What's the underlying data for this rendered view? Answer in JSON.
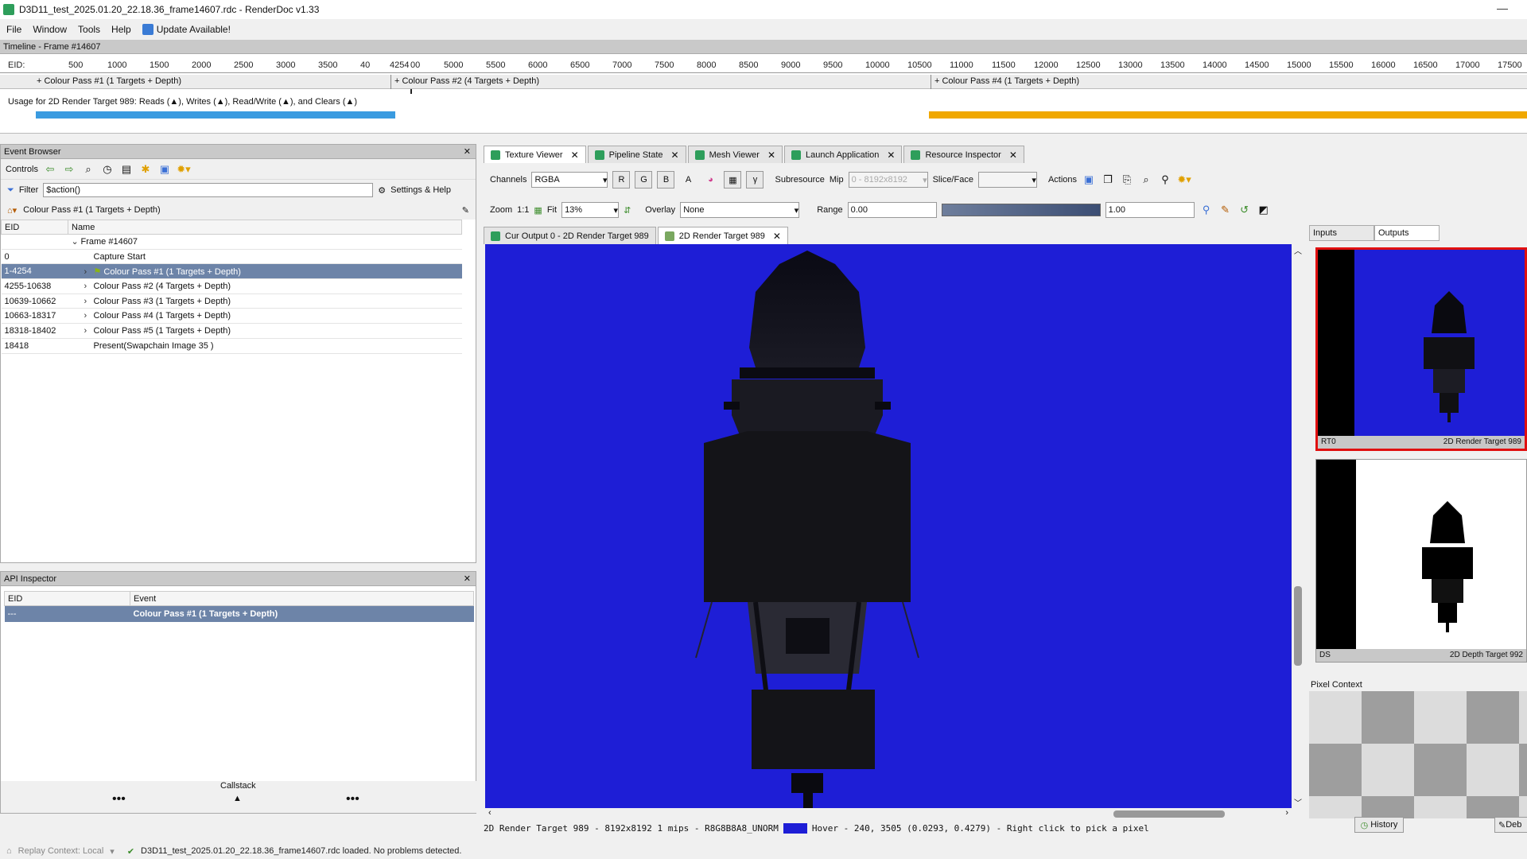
{
  "window": {
    "title": "D3D11_test_2025.01.20_22.18.36_frame14607.rdc - RenderDoc v1.33",
    "minimize": "—"
  },
  "menu": {
    "file": "File",
    "window": "Window",
    "tools": "Tools",
    "help": "Help",
    "update": "Update Available!"
  },
  "timeline": {
    "title": "Timeline - Frame #14607",
    "eid_label": "EID:",
    "ticks": [
      "500",
      "1000",
      "1500",
      "2000",
      "2500",
      "3000",
      "3500",
      "40",
      "4254",
      "00",
      "5000",
      "5500",
      "6000",
      "6500",
      "7000",
      "7500",
      "8000",
      "8500",
      "9000",
      "9500",
      "10000",
      "10500",
      "11000",
      "11500",
      "12000",
      "12500",
      "13000",
      "13500",
      "14000",
      "14500",
      "15000",
      "15500",
      "16000",
      "16500",
      "17000",
      "17500"
    ],
    "passes": [
      "+ Colour Pass #1 (1 Targets + Depth)",
      "+ Colour Pass #2 (4 Targets + Depth)",
      "+ Colour Pass #4 (1 Targets + Depth)"
    ],
    "usage_text": "Usage for 2D Render Target 989: Reads (▲), Writes (▲), Read/Write (▲), and Clears (▲)",
    "colors": {
      "reads": "#3a9be0",
      "writes": "#f0a800"
    }
  },
  "event_browser": {
    "title": "Event Browser",
    "controls": "Controls",
    "filter_label": "Filter",
    "filter_value": "$action()",
    "settings_help": "Settings & Help",
    "breadcrumb": "Colour Pass #1 (1 Targets + Depth)",
    "col_eid": "EID",
    "col_name": "Name",
    "rows": [
      {
        "eid": "",
        "name": "Frame #14607",
        "chev": "⌄",
        "indent": 0
      },
      {
        "eid": "0",
        "name": "Capture Start",
        "chev": "",
        "indent": 1
      },
      {
        "eid": "1-4254",
        "name": "Colour Pass #1 (1 Targets + Depth)",
        "chev": "›",
        "indent": 1,
        "selected": true
      },
      {
        "eid": "4255-10638",
        "name": "Colour Pass #2 (4 Targets + Depth)",
        "chev": "›",
        "indent": 1
      },
      {
        "eid": "10639-10662",
        "name": "Colour Pass #3 (1 Targets + Depth)",
        "chev": "›",
        "indent": 1
      },
      {
        "eid": "10663-18317",
        "name": "Colour Pass #4 (1 Targets + Depth)",
        "chev": "›",
        "indent": 1
      },
      {
        "eid": "18318-18402",
        "name": "Colour Pass #5 (1 Targets + Depth)",
        "chev": "›",
        "indent": 1
      },
      {
        "eid": "18418",
        "name": "Present(Swapchain Image 35 )",
        "chev": "",
        "indent": 1
      }
    ]
  },
  "api_inspector": {
    "title": "API Inspector",
    "col_eid": "EID",
    "col_event": "Event",
    "row_eid": "---",
    "row_event": "Colour Pass #1 (1 Targets + Depth)",
    "callstack": "Callstack",
    "dots": "•••"
  },
  "tabs": [
    "Texture Viewer",
    "Pipeline State",
    "Mesh Viewer",
    "Launch Application",
    "Resource Inspector"
  ],
  "texture_viewer": {
    "channels_label": "Channels",
    "channels_value": "RGBA",
    "ch_r": "R",
    "ch_g": "G",
    "ch_b": "B",
    "ch_a": "A",
    "gamma": "γ",
    "subresource": "Subresource",
    "mip_label": "Mip",
    "mip_value": "0 - 8192x8192",
    "slice_label": "Slice/Face",
    "actions": "Actions",
    "zoom_label": "Zoom",
    "zoom_11": "1:1",
    "fit": "Fit",
    "zoom_value": "13%",
    "overlay_label": "Overlay",
    "overlay_value": "None",
    "range_label": "Range",
    "range_min": "0.00",
    "range_max": "1.00",
    "subtabs": [
      "Cur Output 0 - 2D Render Target 989",
      "2D Render Target 989"
    ],
    "status": "2D Render Target 989 - 8192x8192 1 mips - R8G8B8A8_UNORM",
    "hover": "Hover -   240, 3505 (0.0293, 0.4279)  - Right click to pick a pixel",
    "bg_color": "#1e1ed6"
  },
  "thumbnails": {
    "tab_inputs": "Inputs",
    "tab_outputs": "Outputs",
    "rt0_slot": "RT0",
    "rt0_name": "2D Render Target 989",
    "ds_slot": "DS",
    "ds_name": "2D Depth Target 992"
  },
  "pixel_context": {
    "title": "Pixel Context",
    "history": "History",
    "debug": "Deb"
  },
  "statusbar": {
    "replay": "Replay Context: Local",
    "message": "D3D11_test_2025.01.20_22.18.36_frame14607.rdc loaded. No problems detected."
  }
}
